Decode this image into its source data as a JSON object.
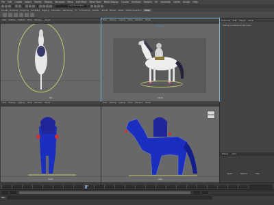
{
  "menubar": {
    "items": [
      "File",
      "Edit",
      "Create",
      "Select",
      "Modify",
      "Display",
      "Windows",
      "Mesh",
      "Edit Mesh",
      "Mesh Tools",
      "Mesh Display",
      "Curves",
      "Surfaces",
      "Deform",
      "UV",
      "Generate",
      "Cache",
      "Arnold",
      "Help"
    ]
  },
  "statusline": {
    "live_label": "No Live Surface"
  },
  "shelf": {
    "tabs": [
      "Curves / Surfaces",
      "Polygons",
      "Sculpting",
      "Rigging",
      "Animation",
      "Rendering",
      "FX",
      "FX Caching",
      "Custom",
      "Arnold",
      "Bifrost",
      "MASH",
      "Motion Graphics",
      "XGen"
    ],
    "active_tab": "XGen"
  },
  "viewports": {
    "menu": [
      "View",
      "Shading",
      "Lighting",
      "Show",
      "Renderer",
      "Panels"
    ],
    "top": {
      "label": "top"
    },
    "persp": {
      "label": "persp",
      "fps": "48.0 fps"
    },
    "front": {
      "label": "front"
    },
    "side": {
      "label": "side"
    },
    "cam_badge": "FRONT"
  },
  "channel_box": {
    "header": [
      "Channels",
      "Edit",
      "Object",
      "Show"
    ],
    "info": "Nothing is selected in the scene",
    "layer_tabs": [
      "Display",
      "Anim"
    ],
    "layer_buttons": [
      "Layers",
      "Options",
      "Help"
    ]
  },
  "timeslider": {
    "current_frame": "32"
  },
  "colors": {
    "background": "#2b2b2b",
    "viewport_bg": "#686868",
    "wireframe": "#1a2fbf",
    "selection": "#c8c870",
    "horse": "#e8e8e8",
    "accent": "#7fb2d9"
  }
}
